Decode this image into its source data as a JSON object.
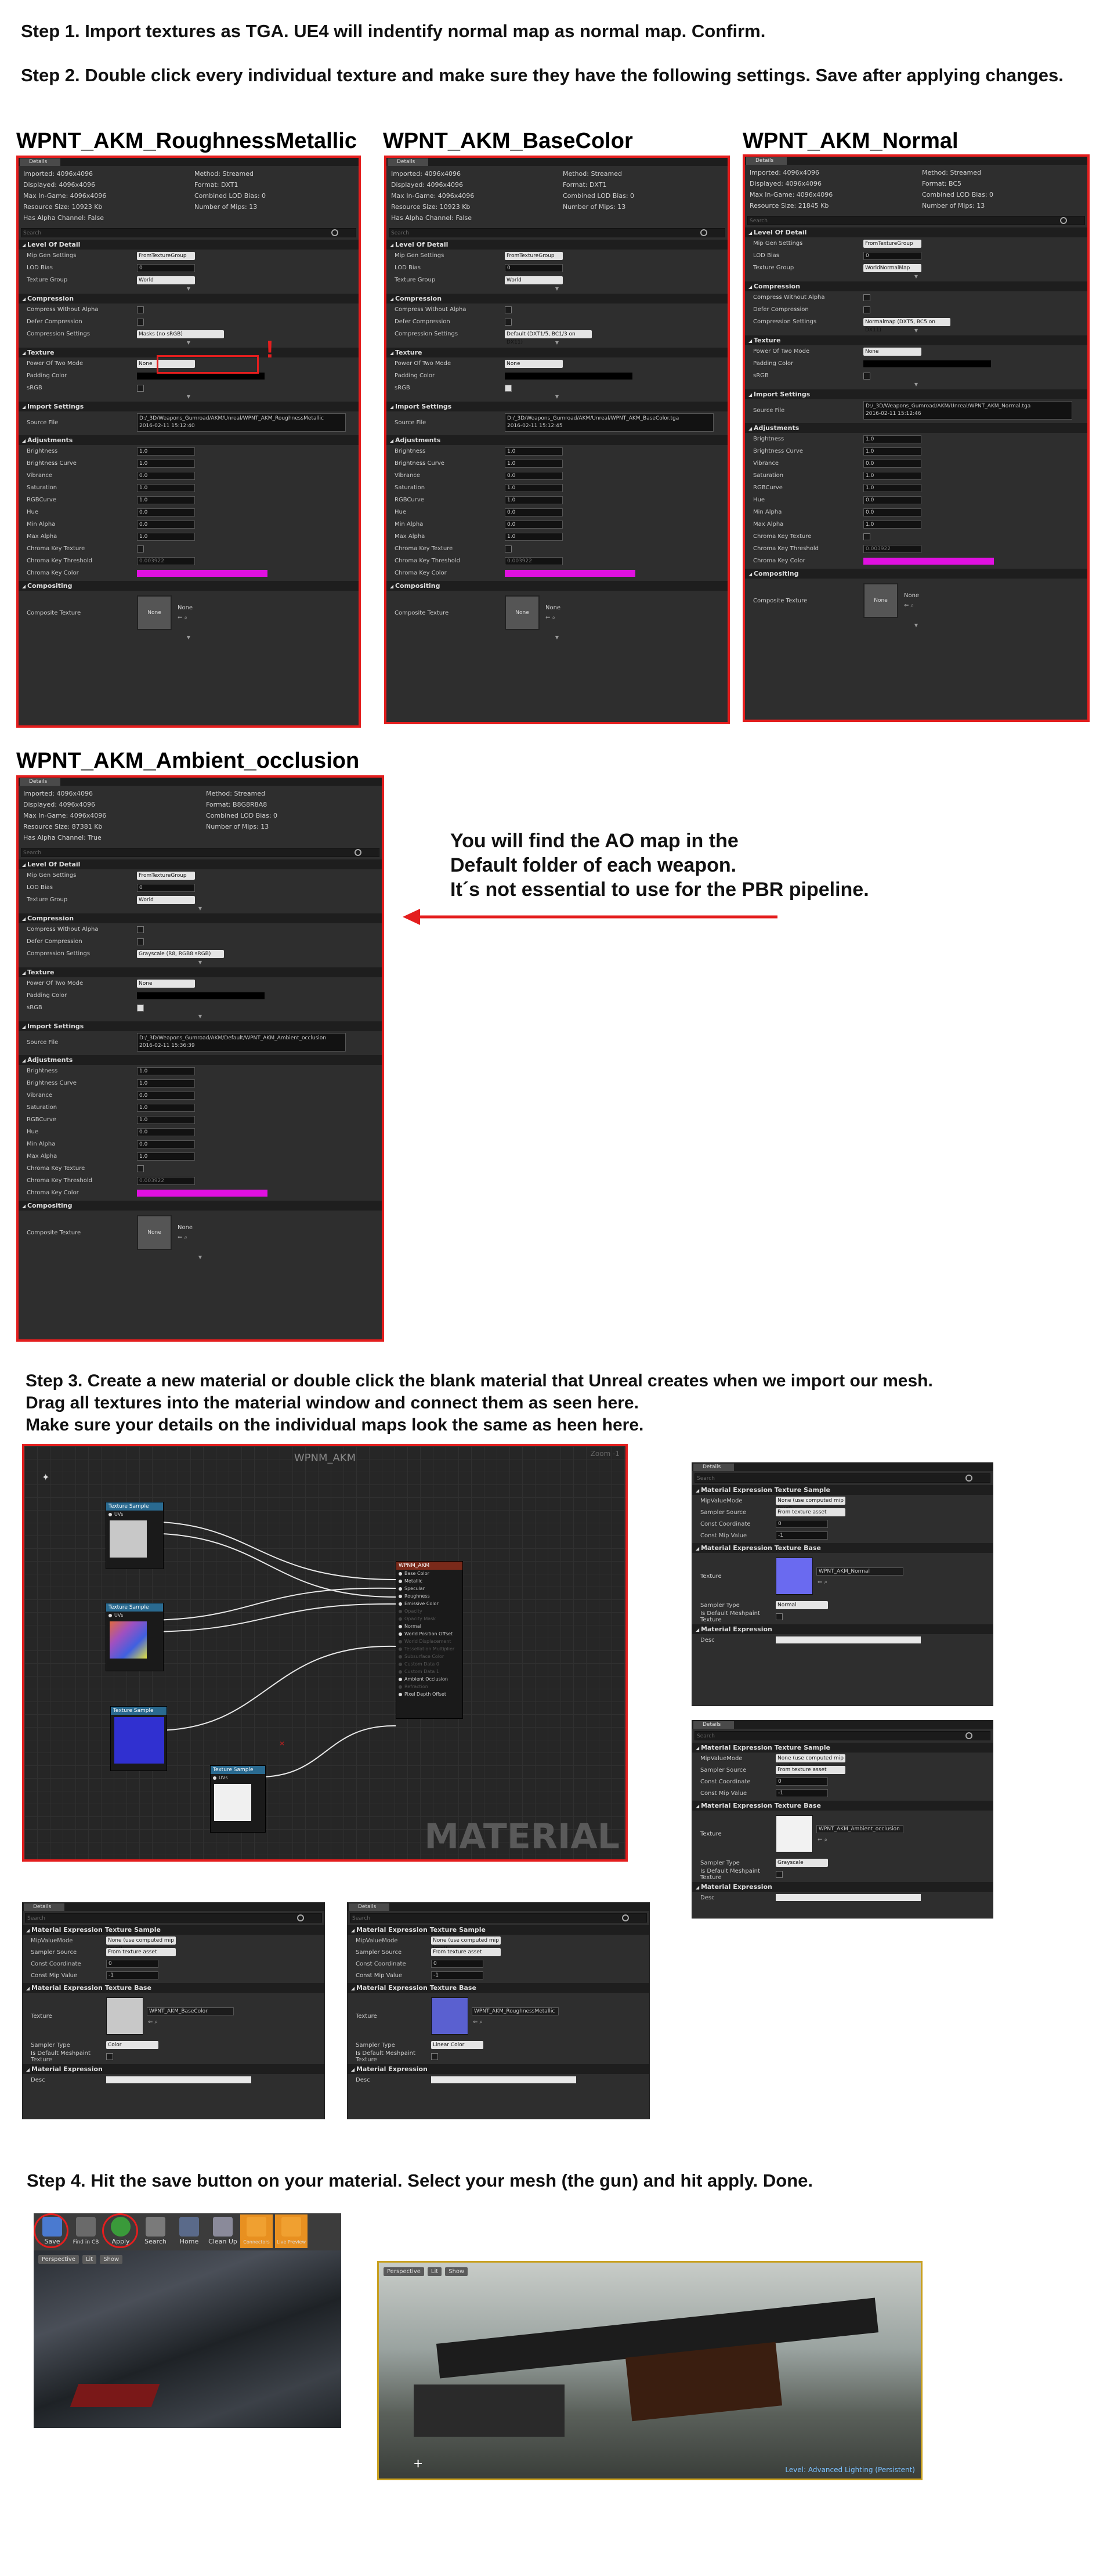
{
  "steps": {
    "step1": "Step 1.  Import textures as TGA. UE4 will indentify normal map as normal map. Confirm.",
    "step2": "Step 2. Double click every individual texture and make sure they have the following settings. Save after applying changes.",
    "step3_line1": "Step 3. Create a new material or double click the blank material that Unreal creates when we import our mesh.",
    "step3_line2": "Drag all textures into the material window and connect them as seen here.",
    "step3_line3": "Make sure your details on the individual maps look the same as heen here.",
    "step4": "Step 4. Hit the save button on your material. Select your mesh (the gun) and hit apply. Done."
  },
  "ao_note": {
    "line1": "You will find the AO map in the",
    "line2": "Default folder of each weapon.",
    "line3": "It´s not essential to use for the PBR pipeline."
  },
  "common": {
    "details_tab": "Details",
    "search_placeholder": "Search",
    "cat_lod": "Level Of Detail",
    "cat_compression": "Compression",
    "cat_texture": "Texture",
    "cat_import": "Import Settings",
    "cat_adjust": "Adjustments",
    "cat_compositing": "Compositing",
    "mip_gen": "Mip Gen Settings",
    "lod_bias": "LOD Bias",
    "texture_group": "Texture Group",
    "compress_no_alpha": "Compress Without Alpha",
    "defer_compression": "Defer Compression",
    "compression_settings": "Compression Settings",
    "power_two": "Power Of Two Mode",
    "padding_color": "Padding Color",
    "srgb": "sRGB",
    "source_file": "Source File",
    "brightness": "Brightness",
    "brightness_curve": "Brightness Curve",
    "vibrance": "Vibrance",
    "saturation": "Saturation",
    "rgb_curve": "RGBCurve",
    "hue": "Hue",
    "min_alpha": "Min Alpha",
    "max_alpha": "Max Alpha",
    "chroma_key_texture": "Chroma Key Texture",
    "chroma_key_threshold": "Chroma Key Threshold",
    "chroma_key_color": "Chroma Key Color",
    "composite_texture": "Composite Texture",
    "none": "None",
    "from_texture_group": "FromTextureGroup",
    "world": "World",
    "zero": "0",
    "one": "1.0",
    "zero_f": "0.0",
    "threshold": "0.003922"
  },
  "panels": [
    {
      "title": "WPNT_AKM_RoughnessMetallic",
      "info": [
        "Imported: 4096x4096",
        "Method: Streamed",
        "Displayed: 4096x4096",
        "Format: DXT1",
        "Max In-Game: 4096x4096",
        "Combined LOD Bias: 0",
        "Resource Size: 10923 Kb",
        "Number of Mips: 13",
        "Has Alpha Channel: False",
        ""
      ],
      "texture_group": "World",
      "compression": "Masks (no sRGB)",
      "source": "D:/_3D/Weapons_Gumroad/AKM/Unreal/WPNT_AKM_RoughnessMetallic",
      "date": "2016-02-11 15:12:40",
      "srgb": false
    },
    {
      "title": "WPNT_AKM_BaseColor",
      "info": [
        "Imported: 4096x4096",
        "Method: Streamed",
        "Displayed: 4096x4096",
        "Format: DXT1",
        "Max In-Game: 4096x4096",
        "Combined LOD Bias: 0",
        "Resource Size: 10923 Kb",
        "Number of Mips: 13",
        "Has Alpha Channel: False",
        ""
      ],
      "texture_group": "World",
      "compression": "Default (DXT1/5, BC1/3 on DX11)",
      "source": "D:/_3D/Weapons_Gumroad/AKM/Unreal/WPNT_AKM_BaseColor.tga",
      "date": "2016-02-11 15:12:45",
      "srgb": true
    },
    {
      "title": "WPNT_AKM_Normal",
      "info": [
        "Imported: 4096x4096",
        "Method: Streamed",
        "Displayed: 4096x4096",
        "Format: BC5",
        "Max In-Game: 4096x4096",
        "Combined LOD Bias: 0",
        "Resource Size: 21845 Kb",
        "Number of Mips: 13",
        "",
        ""
      ],
      "texture_group": "WorldNormalMap",
      "compression": "Normalmap (DXT5, BC5 on DX11)",
      "source": "D:/_3D/Weapons_Gumroad/AKM/Unreal/WPNT_AKM_Normal.tga",
      "date": "2016-02-11 15:12:46",
      "srgb": false
    },
    {
      "title": "WPNT_AKM_Ambient_occlusion",
      "info": [
        "Imported: 4096x4096",
        "Method: Streamed",
        "Displayed: 4096x4096",
        "Format: B8G8R8A8",
        "Max In-Game: 4096x4096",
        "Combined LOD Bias: 0",
        "Resource Size: 87381 Kb",
        "Number of Mips: 13",
        "Has Alpha Channel: True",
        ""
      ],
      "texture_group": "World",
      "compression": "Grayscale (R8, RGB8 sRGB)",
      "source": "D:/_3D/Weapons_Gumroad/AKM/Default/WPNT_AKM_Ambient_occlusion",
      "date": "2016-02-11 15:36:39",
      "srgb": true
    }
  ],
  "graph": {
    "title": "WPNM_AKM",
    "zoom": "Zoom -1",
    "watermark": "MATERIAL",
    "node_label": "Texture Sample",
    "uvs": "UVs",
    "material_node": "WPNM_AKM",
    "pins": [
      "Base Color",
      "Metallic",
      "Specular",
      "Roughness",
      "Emissive Color",
      "Opacity",
      "Opacity Mask",
      "Normal",
      "World Position Offset",
      "World Displacement",
      "Tessellation Multiplier",
      "Subsurface Color",
      "Custom Data 0",
      "Custom Data 1",
      "Ambient Occlusion",
      "Refraction",
      "Pixel Depth Offset"
    ],
    "pin_active": [
      true,
      true,
      true,
      true,
      true,
      false,
      false,
      true,
      true,
      false,
      false,
      false,
      false,
      false,
      true,
      false,
      true
    ]
  },
  "expr": {
    "sample": "Material Expression Texture Sample",
    "mip_mode": "MipValueMode",
    "mip_val": "None (use computed mip level)",
    "sampler_source": "Sampler Source",
    "from_texture_asset": "From texture asset",
    "const_coord": "Const Coordinate",
    "const_mip": "Const Mip Value",
    "minus_one": "-1",
    "base": "Material Expression Texture Base",
    "texture": "Texture",
    "sampler_type": "Sampler Type",
    "default_mesh": "Is Default Meshpaint Texture",
    "material_expression": "Material Expression",
    "desc": "Desc",
    "panels": [
      {
        "tex": "WPNT_AKM_Normal",
        "type": "Normal"
      },
      {
        "tex": "WPNT_AKM_Ambient_occlusion",
        "type": "Grayscale"
      },
      {
        "tex": "WPNT_AKM_BaseColor",
        "type": "Color"
      },
      {
        "tex": "WPNT_AKM_RoughnessMetallic",
        "type": "Linear Color"
      }
    ]
  },
  "toolbar": {
    "save": "Save",
    "find": "Find in CB",
    "apply": "Apply",
    "search": "Search",
    "home": "Home",
    "cleanup": "Clean Up",
    "c1": "Connectors",
    "c2": "Live Preview"
  },
  "viewport": {
    "perspective": "Perspective",
    "lit": "Lit",
    "show": "Show",
    "status": "Level: Advanced Lighting (Persistent)"
  },
  "colors": {
    "frame_red": "#e41e1e",
    "normal_blue": "#6a6af0",
    "chroma_magenta": "#e010e0"
  }
}
